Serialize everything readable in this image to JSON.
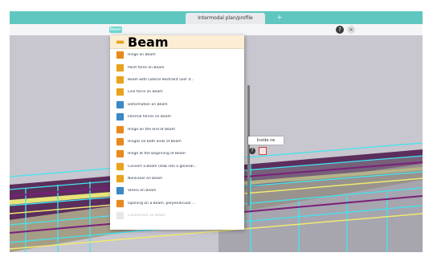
{
  "window": {
    "tab_title": "Intermodal plan/profile",
    "tab_close": "+"
  },
  "toolbar": {
    "chip": "Beam",
    "help_icon": "?",
    "close_icon": "×"
  },
  "menu": {
    "header": "Beam",
    "items": [
      {
        "label": "Hinge on Beam",
        "icon": "hinge-icon",
        "color": "#e8891f"
      },
      {
        "label": "Point force on Beam",
        "icon": "point-force-icon",
        "color": "#e8a21f"
      },
      {
        "label": "Beam with Lateral Restraint user d...",
        "icon": "beam-restraint-icon",
        "color": "#e8a21f"
      },
      {
        "label": "Line force on Beam",
        "icon": "line-force-icon",
        "color": "#e8a21f"
      },
      {
        "label": "Deformation on Beam",
        "icon": "deformation-icon",
        "color": "#3d87c4"
      },
      {
        "label": "Internal forces on Beam",
        "icon": "internal-forces-icon",
        "color": "#3d87c4"
      },
      {
        "label": "Hinge on the end of Beam",
        "icon": "hinge-end-icon",
        "color": "#e8891f"
      },
      {
        "label": "Hinges on both ends of Beam",
        "icon": "hinges-both-icon",
        "color": "#e8891f"
      },
      {
        "label": "Hinge at the beginning of Beam",
        "icon": "hinge-begin-icon",
        "color": "#e8891f"
      },
      {
        "label": "Convert a Beam (slab into a general...",
        "icon": "convert-icon",
        "color": "#e8a21f"
      },
      {
        "label": "Nonlinear on Beam",
        "icon": "nonlinear-icon",
        "color": "#e8a21f"
      },
      {
        "label": "Stress on Beam",
        "icon": "stress-icon",
        "color": "#3d87c4"
      },
      {
        "label": "Opening on a Beam, perpendicular ...",
        "icon": "opening-icon",
        "color": "#e8891f"
      },
      {
        "label": "Connection on Beam",
        "icon": "connection-icon",
        "color": "#bbbbbb",
        "faded": true
      }
    ]
  },
  "tooltip": {
    "label": "Inside ne",
    "help": "?"
  },
  "colors": {
    "accent": "#5fc6c0",
    "beam": "#e8a21f",
    "cyan_lines": "#3fe6f2"
  }
}
